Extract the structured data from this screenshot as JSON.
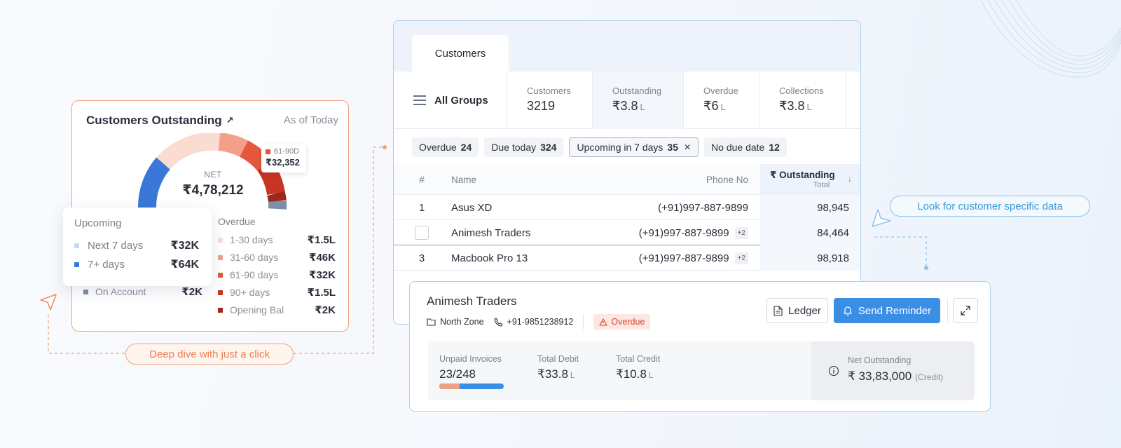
{
  "colors": {
    "accent_orange": "#f0a27c",
    "accent_blue": "#3a8ee6",
    "overdue_red": "#d8472e"
  },
  "customers_outstanding": {
    "title": "Customers Outstanding",
    "as_of": "As of Today",
    "net_label": "NET",
    "net_value": "₹4,78,212",
    "tooltip": {
      "label": "61-90D",
      "value": "₹32,352"
    },
    "overdue_header": "Overdue",
    "overdue_rows": [
      {
        "label": "1-30 days",
        "value": "₹1.5L",
        "color": "#fadcd3"
      },
      {
        "label": "31-60 days",
        "value": "₹46K",
        "color": "#f2a08a"
      },
      {
        "label": "61-90 days",
        "value": "₹32K",
        "color": "#e5583d"
      },
      {
        "label": "90+ days",
        "value": "₹1.5L",
        "color": "#c73523"
      },
      {
        "label": "Opening Bal",
        "value": "₹2K",
        "color": "#9c2a1c"
      }
    ],
    "on_account": {
      "label": "On Account",
      "value": "₹2K"
    },
    "upcoming": {
      "header": "Upcoming",
      "rows": [
        {
          "label": "Next 7 days",
          "value": "₹32K",
          "color": "#c3daf3"
        },
        {
          "label": "7+ days",
          "value": "₹64K",
          "color": "#3a78d8"
        }
      ]
    }
  },
  "callouts": {
    "deep_dive": "Deep dive with just a click",
    "customer_data": "Look for customer specific data"
  },
  "table_panel": {
    "tab": "Customers",
    "group": "All Groups",
    "stats": [
      {
        "label": "Customers",
        "value": "3219",
        "unit": ""
      },
      {
        "label": "Outstanding",
        "value": "₹3.8",
        "unit": "L"
      },
      {
        "label": "Overdue",
        "value": "₹6",
        "unit": "L"
      },
      {
        "label": "Collections",
        "value": "₹3.8",
        "unit": "L"
      }
    ],
    "filters": [
      {
        "label": "Overdue",
        "count": "24"
      },
      {
        "label": "Due today",
        "count": "324"
      },
      {
        "label": "Upcoming in 7 days",
        "count": "35"
      },
      {
        "label": "No due date",
        "count": "12"
      }
    ],
    "columns": {
      "num": "#",
      "name": "Name",
      "phone": "Phone No",
      "outstanding": "₹ Outstanding",
      "outstanding_sub": "Total"
    },
    "rows": [
      {
        "num": "1",
        "name": "Asus XD",
        "phone": "(+91)997-887-9899",
        "extra": "",
        "outstanding": "98,945"
      },
      {
        "num": "",
        "name": "Animesh Traders",
        "phone": "(+91)997-887-9899",
        "extra": "+2",
        "outstanding": "84,464"
      },
      {
        "num": "3",
        "name": "Macbook Pro 13",
        "phone": "(+91)997-887-9899",
        "extra": "+2",
        "outstanding": "98,918"
      }
    ]
  },
  "detail": {
    "name": "Animesh Traders",
    "zone": "North Zone",
    "phone": "+91-9851238912",
    "status": "Overdue",
    "ledger_label": "Ledger",
    "reminder_label": "Send Reminder",
    "unpaid_label": "Unpaid Invoices",
    "unpaid_value": "23/248",
    "unpaid_fraction": 0.32,
    "debit_label": "Total Debit",
    "debit_value": "₹33.8",
    "debit_unit": "L",
    "credit_label": "Total Credit",
    "credit_value": "₹10.8",
    "credit_unit": "L",
    "net_label": "Net Outstanding",
    "net_value": "₹ 33,83,000",
    "net_note": "(Credit)"
  }
}
